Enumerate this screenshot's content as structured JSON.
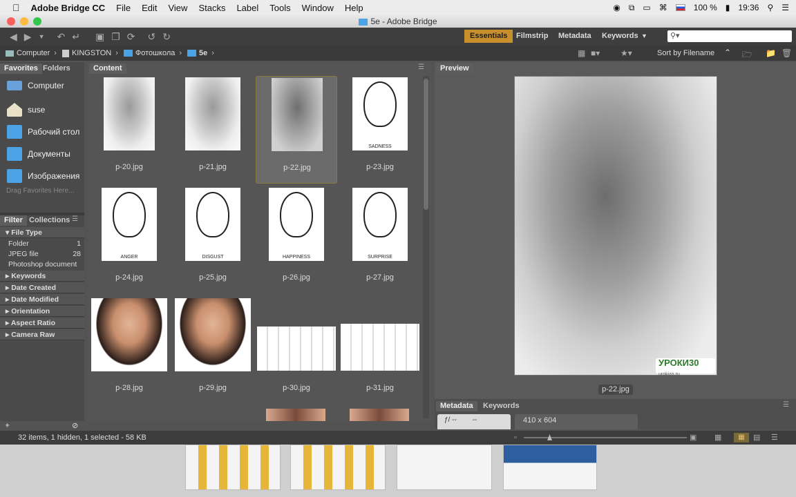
{
  "menubar": {
    "app_name": "Adobe Bridge CC",
    "items": [
      "File",
      "Edit",
      "View",
      "Stacks",
      "Label",
      "Tools",
      "Window",
      "Help"
    ],
    "battery": "100 %",
    "time": "19:36"
  },
  "window": {
    "title": "5e - Adobe Bridge"
  },
  "toolbar": {
    "workspaces": [
      "Essentials",
      "Filmstrip",
      "Metadata",
      "Keywords"
    ],
    "active_workspace": "Essentials",
    "search_placeholder": ""
  },
  "path": [
    "Computer",
    "KINGSTON",
    "Фотошкола",
    "5e"
  ],
  "sort_label": "Sort by Filename",
  "favorites_panel": {
    "tabs": [
      "Favorites",
      "Folders"
    ],
    "items": [
      "Computer",
      "suse",
      "Рабочий стол",
      "Документы",
      "Изображения"
    ],
    "drag_hint": "Drag Favorites Here..."
  },
  "filter_panel": {
    "tabs": [
      "Filter",
      "Collections"
    ],
    "file_type_header": "File Type",
    "file_types": [
      {
        "name": "Folder",
        "count": "1"
      },
      {
        "name": "JPEG file",
        "count": "28"
      },
      {
        "name": "Photoshop document",
        "count": ""
      }
    ],
    "sections": [
      "Keywords",
      "Date Created",
      "Date Modified",
      "Orientation",
      "Aspect Ratio",
      "Camera Raw"
    ]
  },
  "content_panel": {
    "tab": "Content",
    "thumbnails": [
      {
        "name": "p-20.jpg",
        "kind": "sketch"
      },
      {
        "name": "p-21.jpg",
        "kind": "sketch"
      },
      {
        "name": "p-22.jpg",
        "kind": "sketch",
        "selected": true
      },
      {
        "name": "p-23.jpg",
        "kind": "face",
        "caption": "SADNESS"
      },
      {
        "name": "p-24.jpg",
        "kind": "face",
        "caption": "ANGER"
      },
      {
        "name": "p-25.jpg",
        "kind": "face",
        "caption": "DISGUST"
      },
      {
        "name": "p-26.jpg",
        "kind": "face",
        "caption": "HAPPINESS"
      },
      {
        "name": "p-27.jpg",
        "kind": "face",
        "caption": "SURPRISE"
      },
      {
        "name": "p-28.jpg",
        "kind": "photo"
      },
      {
        "name": "p-29.jpg",
        "kind": "photo"
      },
      {
        "name": "p-30.jpg",
        "kind": "grid"
      },
      {
        "name": "p-31.jpg",
        "kind": "grid"
      }
    ]
  },
  "preview_panel": {
    "tab": "Preview",
    "filename": "p-22.jpg",
    "watermark": "УРОКИ30",
    "watermark_sub": "urokizo.ru"
  },
  "metadata_panel": {
    "tabs": [
      "Metadata",
      "Keywords"
    ],
    "fstop": "ƒ/ --",
    "exposure": "--",
    "dimensions": "410 x 604"
  },
  "status": "32 items, 1 hidden, 1 selected - 58 KB"
}
